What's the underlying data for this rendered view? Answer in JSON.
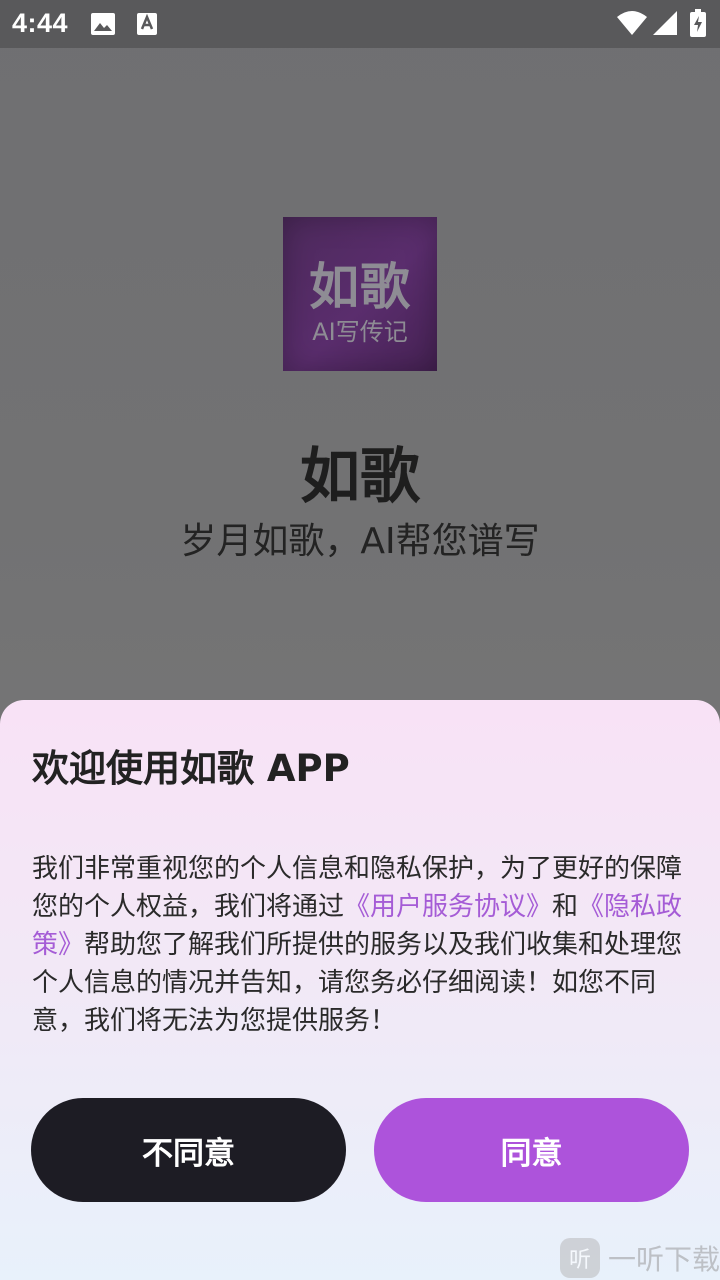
{
  "status_bar": {
    "time": "4:44",
    "icons": [
      "image-icon",
      "text-icon",
      "wifi-icon",
      "signal-icon",
      "battery-icon"
    ]
  },
  "splash": {
    "logo_main": "如歌",
    "logo_sub": "AI写传记",
    "app_name": "如歌",
    "slogan": "岁月如歌，AI帮您谱写"
  },
  "dialog": {
    "title": "欢迎使用如歌 APP",
    "body_part1": "我们非常重视您的个人信息和隐私保护，为了更好的保障您的个人权益，我们将通过",
    "link_user_agreement": "《用户服务协议》",
    "body_part2": "和",
    "link_privacy_policy": "《隐私政策》",
    "body_part3": "帮助您了解我们所提供的服务以及我们收集和处理您个人信息的情况并告知，请您务必仔细阅读！如您不同意，我们将无法为您提供服务！",
    "disagree_label": "不同意",
    "agree_label": "同意"
  },
  "watermark": {
    "icon_char": "听",
    "text": "一听下载"
  },
  "colors": {
    "accent": "#ad53db",
    "link": "#a55cd6",
    "dark_button": "#1d1c24"
  }
}
